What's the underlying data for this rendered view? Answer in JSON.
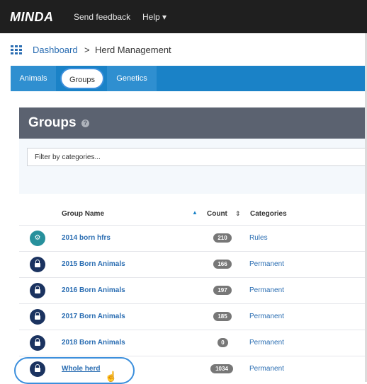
{
  "navbar": {
    "brand": "MINDA",
    "send_feedback": "Send feedback",
    "help": "Help ▾"
  },
  "breadcrumb": {
    "dashboard": "Dashboard",
    "separator": ">",
    "current": "Herd Management"
  },
  "tabs": [
    {
      "label": "Animals"
    },
    {
      "label": "Groups"
    },
    {
      "label": "Genetics"
    }
  ],
  "panel": {
    "title": "Groups",
    "filter_placeholder": "Filter by categories..."
  },
  "table": {
    "headers": {
      "name": "Group Name",
      "count": "Count",
      "categories": "Categories"
    },
    "rows": [
      {
        "name": "2014 born hfrs",
        "count": "210",
        "category": "Rules",
        "icon": "gear-icon"
      },
      {
        "name": "2015 Born Animals",
        "count": "166",
        "category": "Permanent",
        "icon": "lock-icon"
      },
      {
        "name": "2016 Born Animals",
        "count": "197",
        "category": "Permanent",
        "icon": "lock-icon"
      },
      {
        "name": "2017 Born Animals",
        "count": "185",
        "category": "Permanent",
        "icon": "lock-icon"
      },
      {
        "name": "2018 Born Animals",
        "count": "0",
        "category": "Permanent",
        "icon": "lock-icon"
      },
      {
        "name": "Whole herd",
        "count": "1034",
        "category": "Permanent",
        "icon": "lock-icon"
      }
    ]
  },
  "colors": {
    "navbar": "#1f1f1f",
    "tab_bar": "#1a82c7",
    "panel_header": "#5b6270",
    "link": "#2a6db2",
    "lock_icon_bg": "#1b3360",
    "rules_icon_bg": "#27909c",
    "count_badge": "#777777",
    "highlight": "#3c8fdc"
  }
}
